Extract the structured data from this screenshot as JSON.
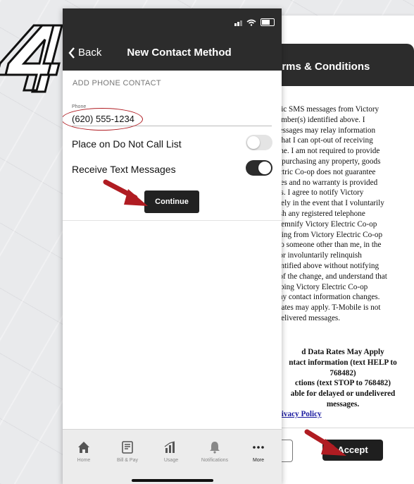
{
  "step_number": "4",
  "terms_screen": {
    "title": "erms & Conditions",
    "body_lines": [
      "odic SMS messages from Victory",
      "number(s) identified above. I",
      "messages may relay information",
      "d that I can opt-out of receiving",
      "time. I am not required to provide",
      "of purchasing any property, goods",
      "lectric Co-op does not guarantee",
      "ages and no warranty is provided",
      "ges. I agree to notify Victory",
      "iately in the event that I voluntarily",
      "uish any registered telephone",
      "ndemnify Victory Electric Co-op",
      "ulting from Victory Electric Co-op",
      "s to someone other than me, in the",
      "y or involuntarily relinquish",
      "dentified above without notifying",
      "o of the change, and understand that",
      "eeping Victory Electric Co-op",
      "' my contact information changes.",
      "a rates may apply. T-Mobile is not",
      "ndelivered messages."
    ],
    "bold_lines": [
      "d Data Rates May Apply",
      "ntact information (text HELP to",
      "768482)",
      "ctions (text STOP to 768482)",
      "able for delayed or undelivered",
      "messages."
    ],
    "privacy_link": "Privacy Policy",
    "accept_label": "Accept"
  },
  "contact_screen": {
    "back_label": "Back",
    "title": "New Contact Method",
    "section_header": "ADD PHONE CONTACT",
    "phone_label": "Phone",
    "phone_value": "(620) 555-1234",
    "do_not_call_label": "Place on Do Not Call List",
    "do_not_call_on": false,
    "text_messages_label": "Receive Text Messages",
    "text_messages_on": true,
    "continue_label": "Continue",
    "tabs": [
      {
        "label": "Home",
        "icon": "house-icon"
      },
      {
        "label": "Bill & Pay",
        "icon": "bill-icon"
      },
      {
        "label": "Usage",
        "icon": "bar-chart-icon"
      },
      {
        "label": "Notifications",
        "icon": "bell-icon"
      },
      {
        "label": "More",
        "icon": "more-dots-icon"
      }
    ]
  },
  "colors": {
    "header": "#2c2c2c",
    "annotation_red": "#b01c22",
    "button": "#222222"
  }
}
